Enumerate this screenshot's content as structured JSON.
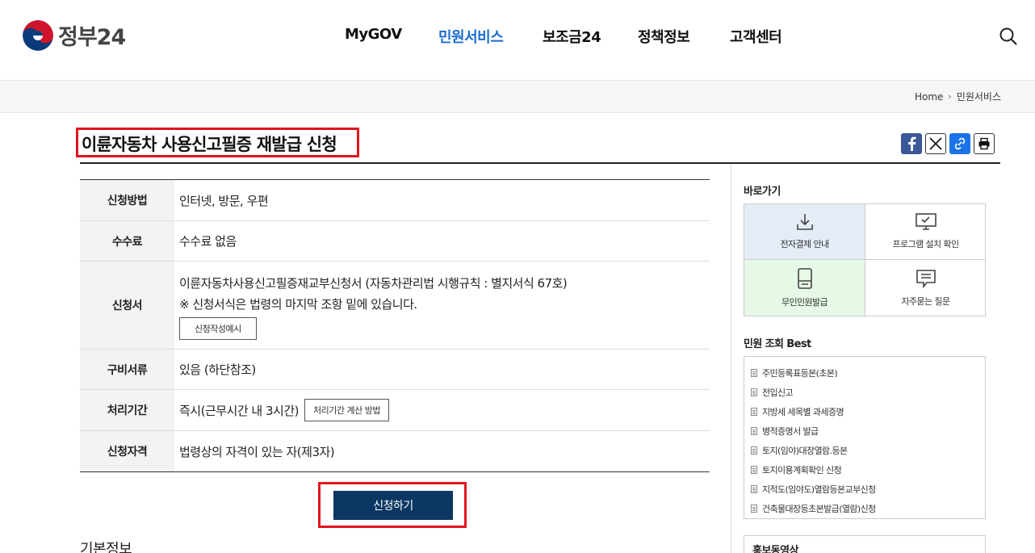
{
  "header": {
    "logo_text": "정부24",
    "nav": [
      "MyGOV",
      "민원서비스",
      "보조금24",
      "정책정보",
      "고객센터"
    ],
    "active_nav": "민원서비스"
  },
  "breadcrumb": {
    "home": "Home",
    "current": "민원서비스"
  },
  "page": {
    "title": "이륜자동차 사용신고필증 재발급 신청"
  },
  "info": {
    "method_label": "신청방법",
    "method_value": "인터넷, 방문, 우편",
    "fee_label": "수수료",
    "fee_value": "수수료 없음",
    "form_label": "신청서",
    "form_value": "이륜자동차사용신고필증재교부신청서 (자동차관리법 시행규칙 : 별지서식 67호)",
    "form_note": "※ 신청서식은 법령의 마지막 조항 밑에 있습니다.",
    "form_example_btn": "신청작성예시",
    "docs_label": "구비서류",
    "docs_value": "있음 (하단참조)",
    "period_label": "처리기간",
    "period_value": "즉시(근무시간 내 3시간)",
    "period_btn": "처리기간 계산 방법",
    "qual_label": "신청자격",
    "qual_value": "법령상의 자격이 있는 자(제3자)"
  },
  "apply_label": "신청하기",
  "basic_info": "기본정보",
  "sidebar": {
    "shortcut_title": "바로가기",
    "shortcuts": [
      "전자결제 안내",
      "프로그램 설치 확인",
      "무인민원발급",
      "자주묻는 질문"
    ],
    "best_title": "민원 조회 Best",
    "best": [
      "주민등록표등본(초본)",
      "전입신고",
      "지방세 세목별 과세증명",
      "병적증명서 발급",
      "토지(임야)대장열람.등본",
      "토지이용계획확인 신청",
      "지적도(임야도)열람등본교부신청",
      "건축물대장등초본발급(열람)신청"
    ],
    "promo_title": "홍보동영상"
  },
  "colors": {
    "accent": "#1a6dcf",
    "highlight": "#e0141e",
    "apply_bg": "#0b3762"
  }
}
